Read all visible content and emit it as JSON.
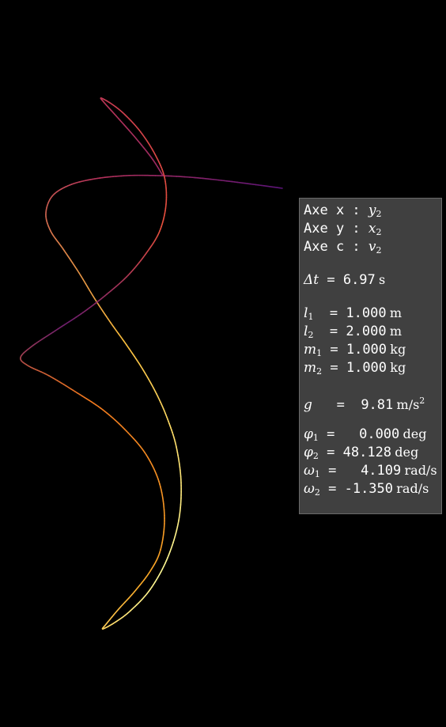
{
  "chart_data": {
    "type": "line",
    "title": "",
    "xlabel": "",
    "ylabel": "",
    "grid": false,
    "colormap": "inferno",
    "background": "#000000",
    "x_axis_quantity": "y2",
    "y_axis_quantity": "x2",
    "color_axis_quantity": "v2"
  },
  "panel": {
    "axes": [
      {
        "label": "Axe x : ",
        "sym": "y",
        "sub": "2"
      },
      {
        "label": "Axe y : ",
        "sym": "x",
        "sub": "2"
      },
      {
        "label": "Axe c : ",
        "sym": "v",
        "sub": "2"
      }
    ],
    "dt": {
      "sym": "Δt",
      "eq": " = ",
      "value": "6.97",
      "unit": "s"
    },
    "params": [
      {
        "sym": "l",
        "sub": "1",
        "eq": "  = ",
        "value": "1.000",
        "unit": "m"
      },
      {
        "sym": "l",
        "sub": "2",
        "eq": "  = ",
        "value": "2.000",
        "unit": "m"
      },
      {
        "sym": "m",
        "sub": "1",
        "eq": " = ",
        "value": "1.000",
        "unit": "kg"
      },
      {
        "sym": "m",
        "sub": "2",
        "eq": " = ",
        "value": "1.000",
        "unit": "kg"
      }
    ],
    "gravity": {
      "sym": "g",
      "eq": "   =  ",
      "value": "9.81",
      "unit": "m/s",
      "unit_sup": "2"
    },
    "state": [
      {
        "sym": "φ",
        "sub": "1",
        "eq": " =  ",
        "value": " 0.000",
        "unit": "deg"
      },
      {
        "sym": "φ",
        "sub": "2",
        "eq": " = ",
        "value": "48.128",
        "unit": "deg"
      },
      {
        "sym": "ω",
        "sub": "1",
        "eq": " =  ",
        "value": " 4.109",
        "unit": "rad/s"
      },
      {
        "sym": "ω",
        "sub": "2",
        "eq": " = ",
        "value": "-1.350",
        "unit": "rad/s"
      }
    ]
  }
}
